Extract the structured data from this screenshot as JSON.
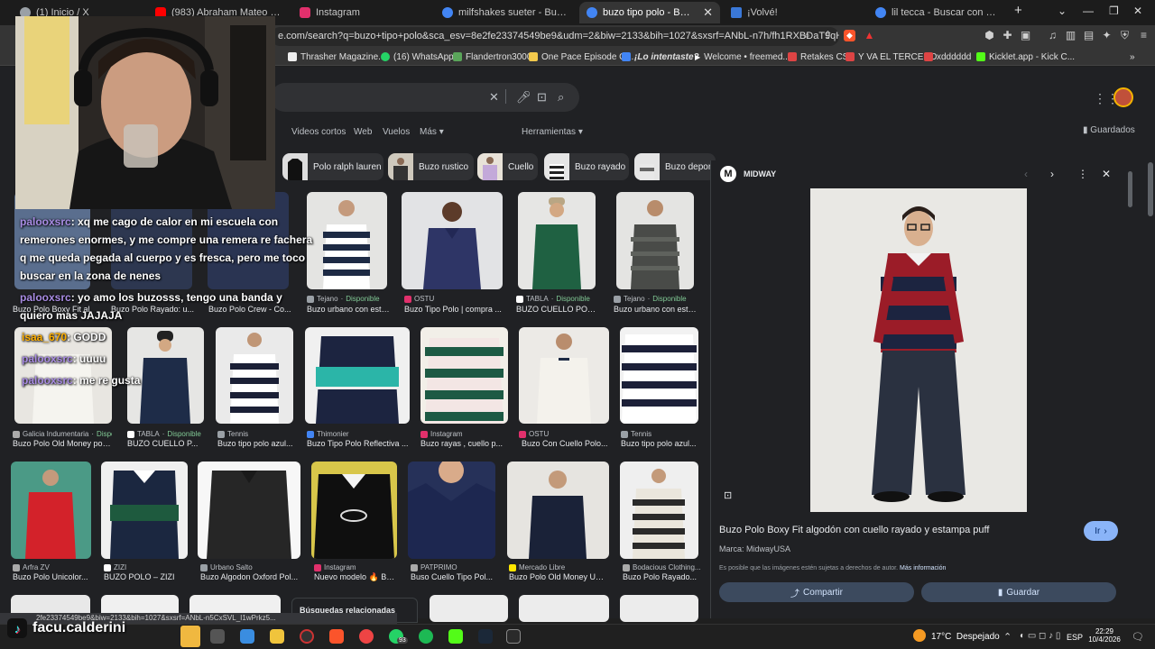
{
  "browser": {
    "tabs": [
      {
        "label": "(1) Inicio / X",
        "color": "#9aa0a6"
      },
      {
        "label": "(983) Abraham Mateo | 21 Días Entr",
        "color": "#ff0000"
      },
      {
        "label": "Instagram",
        "color": "#e1306c"
      },
      {
        "label": "milfshakes sueter - Buscar con Goo",
        "color": "#4285f4"
      },
      {
        "label": "buzo tipo polo - Buscar con Go",
        "color": "#4285f4"
      },
      {
        "label": "¡Volvé!",
        "color": "#3a78d8"
      },
      {
        "label": "lil tecca - Buscar con Google",
        "color": "#4285f4"
      }
    ],
    "new_tab": "+",
    "url": "e.com/search?q=buzo+tipo+polo&sca_esv=8e2fe23374549be9&udm=2&biw=2133&bih=1027&sxsrf=ANbL-n7h/fh1RXBDaT9qH9TmEBf...",
    "bookmarks": [
      {
        "label": "Thrasher Magazine...",
        "color": "#eeeeee"
      },
      {
        "label": "(16) WhatsApp",
        "color": "#25d366"
      },
      {
        "label": "Flandertron3000",
        "color": "#5aa55a"
      },
      {
        "label": "One Pace Episode G...",
        "color": "#f2c94c"
      },
      {
        "label": "¡Lo intentaste?",
        "color": "#4285f4"
      },
      {
        "label": "Welcome • freemed...",
        "color": "#ffffff"
      },
      {
        "label": "Retakes CS",
        "color": "#d44"
      },
      {
        "label": "Y VA EL TERCERO",
        "color": "#d44"
      },
      {
        "label": "xdddddd",
        "color": "#d44"
      },
      {
        "label": "Kicklet.app - Kick C...",
        "color": "#53fc18"
      }
    ]
  },
  "google": {
    "tabs": [
      "Videos cortos",
      "Web",
      "Vuelos",
      "Más"
    ],
    "tools": "Herramientas",
    "saved": "Guardados",
    "chips": [
      "Polo ralph lauren",
      "Buzo rustico",
      "Cuello",
      "Buzo rayado",
      "Buzo deport"
    ],
    "row1": [
      {
        "src": "Tejano",
        "avail": "Disponible",
        "title": "Buzo urbano con esti..."
      },
      {
        "src": "OSTU",
        "avail": "",
        "title": "Buzo Tipo Polo | compra ..."
      },
      {
        "src": "TABLA",
        "avail": "Disponible",
        "title": "BUZO CUELLO POL..."
      },
      {
        "src": "Tejano",
        "avail": "Disponible",
        "title": "Buzo urbano con esti..."
      }
    ],
    "row1_left": [
      "Buzo Polo Boxy Fit al",
      "Buzo Polo Rayado: u...",
      "Buzo Polo Crew - Co..."
    ],
    "row2": [
      {
        "src": "Galicia Indumentaria",
        "avail": "Dispo...",
        "title": "Buzo Polo Old Money por ..."
      },
      {
        "src": "TABLA",
        "avail": "Disponible",
        "title": "BUZO CUELLO P..."
      },
      {
        "src": "Tennis",
        "avail": "",
        "title": "Buzo tipo polo azul..."
      },
      {
        "src": "Thimonier",
        "avail": "",
        "title": "Buzo Tipo Polo Reflectiva ..."
      },
      {
        "src": "Instagram",
        "avail": "",
        "title": "Buzo rayas , cuello p..."
      },
      {
        "src": "OSTU",
        "avail": "",
        "title": "Buzo Con Cuello Polo..."
      },
      {
        "src": "Tennis",
        "avail": "",
        "title": "Buzo tipo polo azul..."
      }
    ],
    "row3": [
      {
        "src": "Arfra ZV",
        "title": "Buzo Polo Unicolor..."
      },
      {
        "src": "ZIZI",
        "title": "BUZO POLO – ZIZI"
      },
      {
        "src": "Urbano Salto",
        "title": "Buzo Algodon Oxford Pol..."
      },
      {
        "src": "Instagram",
        "title": "Nuevo modelo 🔥 Bu..."
      },
      {
        "src": "PATPRIMO",
        "title": "Buso Cuello Tipo Pol..."
      },
      {
        "src": "Mercado Libre",
        "title": "Buzo Polo Old Money Unl..."
      },
      {
        "src": "Bodacious Clothing...",
        "title": "Buzo Polo Rayado..."
      }
    ],
    "related": "Búsquedas relacionadas",
    "status_url": "2fe23374549be9&biw=2133&bih=1027&sxsrf=ANbL-n5CxSVL_I1wPrkz5..."
  },
  "panel": {
    "site": "MIDWAY",
    "site_initial": "M",
    "title": "Buzo Polo Boxy Fit algodón con cuello rayado y estampa puff",
    "brand": "Marca: MidwayUSA",
    "notice": "Es posible que las imágenes estén sujetas a derechos de autor.",
    "more_info": "Más información",
    "go": "Ir",
    "share": "Compartir",
    "save": "Guardar"
  },
  "chat": [
    {
      "user": "palooxsrc",
      "text": ": xq me cago de calor en mi escuela con"
    },
    {
      "user": "",
      "text": "remerones enormes, y me compre una remera re fachera"
    },
    {
      "user": "",
      "text": "q me queda pegada al cuerpo y es fresca, pero me toco"
    },
    {
      "user": "",
      "text": "buscar en la zona de nenes"
    },
    {
      "user": "palooxsrc",
      "text": ": yo amo los buzosss, tengo una banda y"
    },
    {
      "user": "",
      "text": "quiero mas JAJAJA"
    },
    {
      "user": "isaa_670",
      "text": ": GODD"
    },
    {
      "user": "palooxsrc",
      "text": ": uuuu"
    },
    {
      "user": "palooxsrc",
      "text": ": me re gusta"
    }
  ],
  "overlay": {
    "tiktok_name": "facu.calderini"
  },
  "taskbar": {
    "weather": "17°C  Despejado",
    "lang": "ESP",
    "time": "22:29",
    "date": "10/4/2026",
    "whatsapp_badge": "93"
  }
}
